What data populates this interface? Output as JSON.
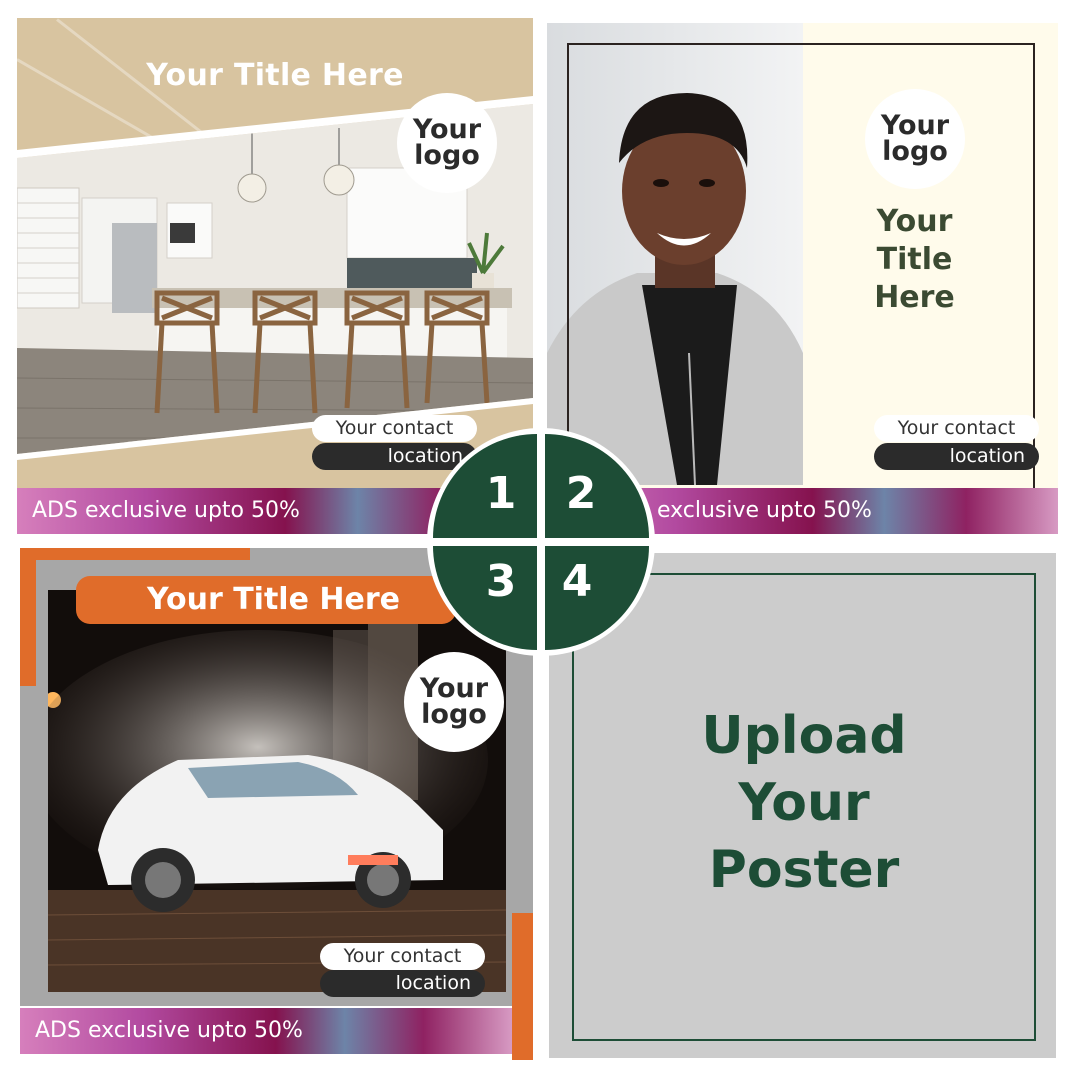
{
  "panels": {
    "kitchen": {
      "title": "Your Title Here",
      "logo_line1": "Your",
      "logo_line2": "logo",
      "contact": "Your contact",
      "location": "location",
      "ads": "ADS exclusive upto 50%"
    },
    "portrait": {
      "logo_line1": "Your",
      "logo_line2": "logo",
      "title_line1": "Your",
      "title_line2": "Title",
      "title_line3": "Here",
      "contact": "Your contact",
      "location": "location",
      "ads": "exclusive upto 50%"
    },
    "car": {
      "title": "Your Title Here",
      "logo_line1": "Your",
      "logo_line2": "logo",
      "contact": "Your contact",
      "location": "location",
      "ads": "ADS exclusive upto 50%"
    },
    "upload": {
      "line1": "Upload",
      "line2": "Your",
      "line3": "Poster"
    }
  },
  "steps": {
    "one": "1",
    "two": "2",
    "three": "3",
    "four": "4"
  },
  "colors": {
    "step_green": "#1d4d36",
    "kitchen_beige": "#d8c4a0",
    "car_orange": "#e06c2a",
    "portrait_cream": "#fffbeb",
    "upload_grey": "#cccccc"
  }
}
